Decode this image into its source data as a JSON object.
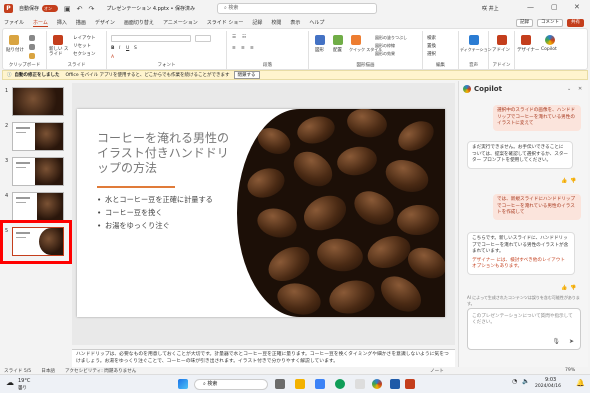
{
  "titlebar": {
    "autosave": "自動保存",
    "toggle": "オン",
    "doc": "プレゼンテーション 4.pptx • 保存済み",
    "search": "検索",
    "user": "咲 井上"
  },
  "menu": {
    "tabs": [
      "ファイル",
      "ホーム",
      "挿入",
      "描画",
      "デザイン",
      "画面切り替え",
      "アニメーション",
      "スライド ショー",
      "記録",
      "校閲",
      "表示",
      "ヘルプ"
    ],
    "active_index": 1,
    "record": "記録",
    "comment": "コメント",
    "share": "共有"
  },
  "ribbon": {
    "clipboard": {
      "label": "クリップボード",
      "paste": "貼り付け"
    },
    "slides": {
      "label": "スライド",
      "new": "新しい スライド",
      "layout": "レイアウト",
      "reset": "リセット",
      "section": "セクション"
    },
    "font": {
      "label": "フォント"
    },
    "paragraph": {
      "label": "段落"
    },
    "drawing": {
      "label": "図形描画",
      "shape": "図形",
      "arrange": "配置",
      "quick": "クイック スタイル",
      "fill": "図形の塗りつぶし",
      "outline": "図形の枠線",
      "effect": "図形の効果"
    },
    "editing": {
      "label": "編集",
      "find": "検索",
      "replace": "置換",
      "select": "選択"
    },
    "voice": {
      "label": "音声",
      "dictate": "ディクテーション"
    },
    "addin": {
      "label": "アドイン",
      "addins": "アドイン"
    },
    "designer": {
      "designer": "デザイナー",
      "copilot": "Copilot"
    }
  },
  "infobar": {
    "title": "自動の修正をしました",
    "text": "Office モバイル アプリを使用すると、どこからでも作業を続けることができます",
    "button": "閉鎖する"
  },
  "thumbnails": [
    {
      "num": "1"
    },
    {
      "num": "2"
    },
    {
      "num": "3"
    },
    {
      "num": "4"
    },
    {
      "num": "5"
    }
  ],
  "slide": {
    "title": "コーヒーを淹れる男性のイラスト付きハンドドリップの方法",
    "bullets": [
      "水とコーヒー豆を正確に計量する",
      "コーヒー豆を挽く",
      "お湯をゆっくり注ぐ"
    ]
  },
  "notes": "ハンドドリップは、必要なものを用意しておくことが大切です。計量器で水とコーヒー豆を正確に量ります。コーヒー豆を挽くタイミングや細かさを意識しないように気をつけましょう。お湯をゆっくり注ぐことで、コーヒーの味が引き出されます。イラスト付きで分かりやすく解説しています。",
  "copilot": {
    "title": "Copilot",
    "messages": [
      {
        "role": "user",
        "text": "選択中のスライドの画像を、ハンドドリップでコーヒーを淹れている男性のイラストに変えて"
      },
      {
        "role": "bot",
        "text": "まだ実行できません。お手伝いできることについては、提案を確認して選択するか、スターター プロンプトを使用してください。"
      },
      {
        "role": "user",
        "text": "では、新規スライドにハンドドリップでコーヒーを淹れている男性のイラストを作成して"
      },
      {
        "role": "bot",
        "text": "こちらです。新しいスライドに、ハンドドリップでコーヒーを淹れている男性のイラストが含まれています。"
      },
      {
        "role": "bot",
        "text": "デザイナー には、検討すべき他のレイアウト オプションもあります。"
      }
    ],
    "hint": "AI によって生成されたコンテンツは誤りを含む可能性があります。",
    "input_placeholder": "このプレゼンテーションについて質問や指示してください。"
  },
  "status": {
    "slide": "スライド 5/5",
    "lang": "日本語",
    "access": "アクセシビリティ: 問題ありません",
    "notes": "ノート",
    "zoom": "79%"
  },
  "taskbar": {
    "weather": "19°C",
    "weather_sub": "曇り",
    "search": "検索",
    "time": "9:03",
    "date": "2024/04/16"
  }
}
